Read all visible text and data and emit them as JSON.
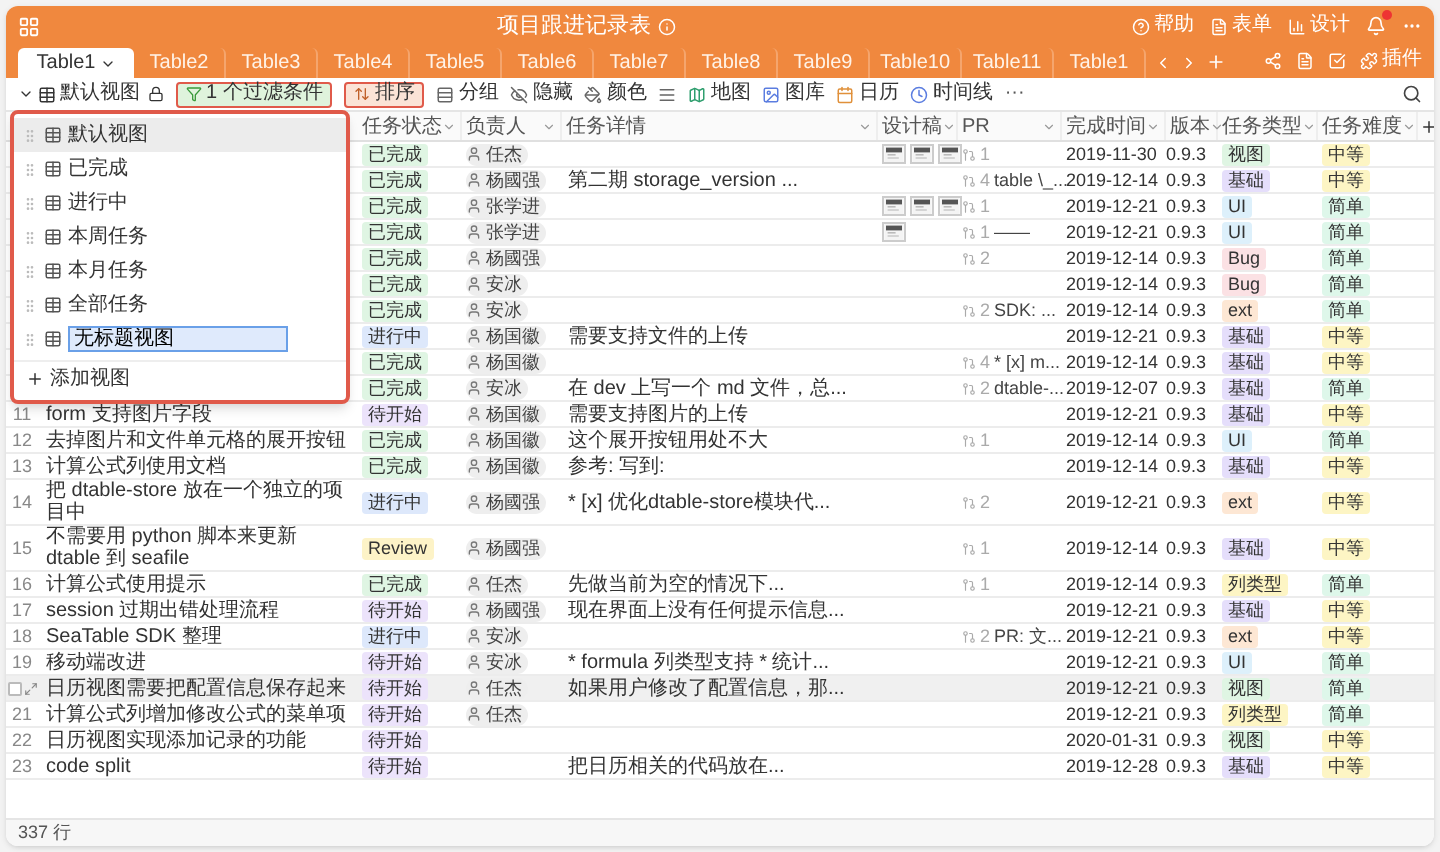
{
  "header": {
    "title": "项目跟进记录表",
    "actions": [
      "帮助",
      "表单",
      "设计"
    ],
    "plugin": "插件"
  },
  "tabs": [
    {
      "label": "Table1",
      "selected": true
    },
    {
      "label": "Table2",
      "selected": false
    },
    {
      "label": "Table3",
      "selected": false
    },
    {
      "label": "Table4",
      "selected": false
    },
    {
      "label": "Table5",
      "selected": false
    },
    {
      "label": "Table6",
      "selected": false
    },
    {
      "label": "Table7",
      "selected": false
    },
    {
      "label": "Table8",
      "selected": false
    },
    {
      "label": "Table9",
      "selected": false
    },
    {
      "label": "Table10",
      "selected": false
    },
    {
      "label": "Table11",
      "selected": false
    },
    {
      "label": "Table1",
      "selected": false
    }
  ],
  "toolbar": [
    {
      "kind": "view",
      "label": "默认视图"
    },
    {
      "kind": "chip",
      "label": "1 个过滤条件",
      "color": "#dff3dc"
    },
    {
      "kind": "chip",
      "label": "排序",
      "color": "#fbe3d6"
    },
    {
      "kind": "tool",
      "label": "分组"
    },
    {
      "kind": "tool",
      "label": "隐藏"
    },
    {
      "kind": "tool",
      "label": "颜色"
    },
    {
      "kind": "icon"
    },
    {
      "kind": "tool",
      "label": "地图"
    },
    {
      "kind": "tool",
      "label": "图库"
    },
    {
      "kind": "tool",
      "label": "日历"
    },
    {
      "kind": "tool",
      "label": "时间线"
    },
    {
      "kind": "more",
      "label": "···"
    }
  ],
  "columns": [
    "任务状态",
    "负责人",
    "任务详情",
    "设计稿",
    "PR",
    "完成时间",
    "版本",
    "任务类型",
    "任务难度"
  ],
  "views": {
    "items": [
      {
        "label": "默认视图",
        "selected": true
      },
      {
        "label": "已完成",
        "selected": false
      },
      {
        "label": "进行中",
        "selected": false
      },
      {
        "label": "本周任务",
        "selected": false
      },
      {
        "label": "本月任务",
        "selected": false
      },
      {
        "label": "全部任务",
        "selected": false
      }
    ],
    "editing": "无标题视图",
    "add": "添加视图"
  },
  "rows": [
    {
      "hovered": false,
      "status": {
        "text": "已完成",
        "color": "#dff5e3"
      },
      "owner": "任杰",
      "pr": {
        "count": "1"
      },
      "date": "2019-11-30",
      "version": "0.9.3",
      "type": {
        "text": "视图",
        "color": "#dff5e3"
      },
      "level": {
        "text": "中等",
        "color": "#fdf5c4"
      }
    },
    {
      "hovered": false,
      "status": {
        "text": "已完成",
        "color": "#dff5e3"
      },
      "owner": "杨國强",
      "detail": "第二期 storage_version ...",
      "pr": {
        "count": "4",
        "text": "table \\_..."
      },
      "date": "2019-12-14",
      "version": "0.9.3",
      "type": {
        "text": "基础",
        "color": "#e5defb"
      },
      "level": {
        "text": "中等",
        "color": "#fdf5c4"
      }
    },
    {
      "hovered": false,
      "status": {
        "text": "已完成",
        "color": "#dff5e3"
      },
      "owner": "张学进",
      "pr": {
        "count": "1"
      },
      "date": "2019-12-21",
      "version": "0.9.3",
      "type": {
        "text": "UI",
        "color": "#ddf0fb"
      },
      "level": {
        "text": "简单",
        "color": "#def7ea"
      }
    },
    {
      "hovered": false,
      "status": {
        "text": "已完成",
        "color": "#dff5e3"
      },
      "owner": "张学进",
      "pr": {
        "count": "1",
        "text": "——"
      },
      "date": "2019-12-21",
      "version": "0.9.3",
      "type": {
        "text": "UI",
        "color": "#ddf0fb"
      },
      "level": {
        "text": "简单",
        "color": "#def7ea"
      }
    },
    {
      "hovered": false,
      "status": {
        "text": "已完成",
        "color": "#dff5e3"
      },
      "owner": "杨國强",
      "pr": {
        "count": "2"
      },
      "date": "2019-12-14",
      "version": "0.9.3",
      "type": {
        "text": "Bug",
        "color": "#fbe1e4"
      },
      "level": {
        "text": "简单",
        "color": "#def7ea"
      }
    },
    {
      "hovered": false,
      "status": {
        "text": "已完成",
        "color": "#dff5e3"
      },
      "owner": "安冰",
      "date": "2019-12-14",
      "version": "0.9.3",
      "type": {
        "text": "Bug",
        "color": "#fbe1e4"
      },
      "level": {
        "text": "简单",
        "color": "#def7ea"
      }
    },
    {
      "hovered": false,
      "status": {
        "text": "已完成",
        "color": "#dff5e3"
      },
      "owner": "安冰",
      "pr": {
        "count": "2",
        "text": "SDK: ..."
      },
      "date": "2019-12-14",
      "version": "0.9.3",
      "type": {
        "text": "ext",
        "color": "#fde7d4"
      },
      "level": {
        "text": "简单",
        "color": "#def7ea"
      }
    },
    {
      "hovered": false,
      "status": {
        "text": "进行中",
        "color": "#dde8fb"
      },
      "owner": "杨国徽",
      "detail": "需要支持文件的上传",
      "date": "2019-12-21",
      "version": "0.9.3",
      "type": {
        "text": "基础",
        "color": "#e5defb"
      },
      "level": {
        "text": "中等",
        "color": "#fdf5c4"
      }
    },
    {
      "hovered": false,
      "status": {
        "text": "已完成",
        "color": "#dff5e3"
      },
      "owner": "杨国徽",
      "pr": {
        "count": "4",
        "text": "* [x] m..."
      },
      "date": "2019-12-14",
      "version": "0.9.3",
      "type": {
        "text": "基础",
        "color": "#e5defb"
      },
      "level": {
        "text": "中等",
        "color": "#fdf5c4"
      }
    },
    {
      "hovered": false,
      "status": {
        "text": "已完成",
        "color": "#dff5e3"
      },
      "owner": "安冰",
      "detail": "在 dev 上写一个 md 文件，总...",
      "pr": {
        "count": "2",
        "text": "dtable-..."
      },
      "date": "2019-12-07",
      "version": "0.9.3",
      "type": {
        "text": "基础",
        "color": "#e5defb"
      },
      "level": {
        "text": "简单",
        "color": "#def7ea"
      }
    },
    {
      "hovered": false,
      "num": "11",
      "title": "form 支持图片字段",
      "status": {
        "text": "待开始",
        "color": "#ece3fb"
      },
      "owner": "杨国徽",
      "detail": "需要支持图片的上传",
      "date": "2019-12-21",
      "version": "0.9.3",
      "type": {
        "text": "基础",
        "color": "#e5defb"
      },
      "level": {
        "text": "中等",
        "color": "#fdf5c4"
      }
    },
    {
      "hovered": false,
      "num": "12",
      "title": "去掉图片和文件单元格的展开按钮",
      "status": {
        "text": "已完成",
        "color": "#dff5e3"
      },
      "owner": "杨国徽",
      "detail": "这个展开按钮用处不大",
      "pr": {
        "count": "1"
      },
      "date": "2019-12-14",
      "version": "0.9.3",
      "type": {
        "text": "UI",
        "color": "#ddf0fb"
      },
      "level": {
        "text": "简单",
        "color": "#def7ea"
      }
    },
    {
      "hovered": false,
      "num": "13",
      "title": "计算公式列使用文档",
      "status": {
        "text": "已完成",
        "color": "#dff5e3"
      },
      "owner": "杨国徽",
      "detail": "参考: 写到:",
      "date": "2019-12-14",
      "version": "0.9.3",
      "type": {
        "text": "基础",
        "color": "#e5defb"
      },
      "level": {
        "text": "中等",
        "color": "#fdf5c4"
      }
    },
    {
      "hovered": false,
      "num": "14",
      "title": "把 dtable-store 放在一个独立的项目中",
      "status": {
        "text": "进行中",
        "color": "#dde8fb"
      },
      "owner": "杨國强",
      "detail": "* [x] 优化dtable-store模块代...",
      "pr": {
        "count": "2"
      },
      "date": "2019-12-21",
      "version": "0.9.3",
      "type": {
        "text": "ext",
        "color": "#fde7d4"
      },
      "level": {
        "text": "中等",
        "color": "#fdf5c4"
      }
    },
    {
      "hovered": false,
      "num": "15",
      "title": "不需要用 python 脚本来更新 dtable 到 seafile",
      "status": {
        "text": "Review",
        "color": "#fdf3c7"
      },
      "owner": "杨國强",
      "pr": {
        "count": "1"
      },
      "date": "2019-12-14",
      "version": "0.9.3",
      "type": {
        "text": "基础",
        "color": "#e5defb"
      },
      "level": {
        "text": "中等",
        "color": "#fdf5c4"
      }
    },
    {
      "hovered": false,
      "num": "16",
      "title": "计算公式使用提示",
      "status": {
        "text": "已完成",
        "color": "#dff5e3"
      },
      "owner": "任杰",
      "detail": "先做当前为空的情况下...",
      "pr": {
        "count": "1"
      },
      "date": "2019-12-14",
      "version": "0.9.3",
      "type": {
        "text": "列类型",
        "color": "#fdf5c4"
      },
      "level": {
        "text": "简单",
        "color": "#def7ea"
      }
    },
    {
      "hovered": false,
      "num": "17",
      "title": "session 过期出错处理流程",
      "status": {
        "text": "待开始",
        "color": "#ece3fb"
      },
      "owner": "杨國强",
      "detail": "现在界面上没有任何提示信息...",
      "date": "2019-12-21",
      "version": "0.9.3",
      "type": {
        "text": "基础",
        "color": "#e5defb"
      },
      "level": {
        "text": "中等",
        "color": "#fdf5c4"
      }
    },
    {
      "hovered": false,
      "num": "18",
      "title": "SeaTable SDK 整理",
      "status": {
        "text": "进行中",
        "color": "#dde8fb"
      },
      "owner": "安冰",
      "pr": {
        "count": "2",
        "text": "PR: 文..."
      },
      "date": "2019-12-21",
      "version": "0.9.3",
      "type": {
        "text": "ext",
        "color": "#fde7d4"
      },
      "level": {
        "text": "中等",
        "color": "#fdf5c4"
      }
    },
    {
      "hovered": false,
      "num": "19",
      "title": "移动端改进",
      "status": {
        "text": "待开始",
        "color": "#ece3fb"
      },
      "owner": "安冰",
      "detail": "* formula 列类型支持 * 统计...",
      "date": "2019-12-21",
      "version": "0.9.3",
      "type": {
        "text": "UI",
        "color": "#ddf0fb"
      },
      "level": {
        "text": "简单",
        "color": "#def7ea"
      }
    },
    {
      "hovered": true,
      "title": "日历视图需要把配置信息保存起来",
      "status": {
        "text": "待开始",
        "color": "#ece3fb"
      },
      "owner": "任杰",
      "detail": "如果用户修改了配置信息，那...",
      "date": "2019-12-21",
      "version": "0.9.3",
      "type": {
        "text": "视图",
        "color": "#dff5e3"
      },
      "level": {
        "text": "简单",
        "color": "#def7ea"
      }
    },
    {
      "hovered": false,
      "num": "21",
      "title": "计算公式列增加修改公式的菜单项",
      "status": {
        "text": "待开始",
        "color": "#ece3fb"
      },
      "owner": "任杰",
      "date": "2019-12-21",
      "version": "0.9.3",
      "type": {
        "text": "列类型",
        "color": "#fdf5c4"
      },
      "level": {
        "text": "简单",
        "color": "#def7ea"
      }
    },
    {
      "hovered": false,
      "num": "22",
      "title": "日历视图实现添加记录的功能",
      "status": {
        "text": "待开始",
        "color": "#ece3fb"
      },
      "date": "2020-01-31",
      "version": "0.9.3",
      "type": {
        "text": "视图",
        "color": "#dff5e3"
      },
      "level": {
        "text": "中等",
        "color": "#fdf5c4"
      }
    },
    {
      "hovered": false,
      "num": "23",
      "title": "code split",
      "status": {
        "text": "待开始",
        "color": "#ece3fb"
      },
      "detail": "把日历相关的代码放在...",
      "date": "2019-12-28",
      "version": "0.9.3",
      "type": {
        "text": "基础",
        "color": "#e5defb"
      },
      "level": {
        "text": "中等",
        "color": "#fdf5c4"
      }
    }
  ],
  "footer": "337 行"
}
